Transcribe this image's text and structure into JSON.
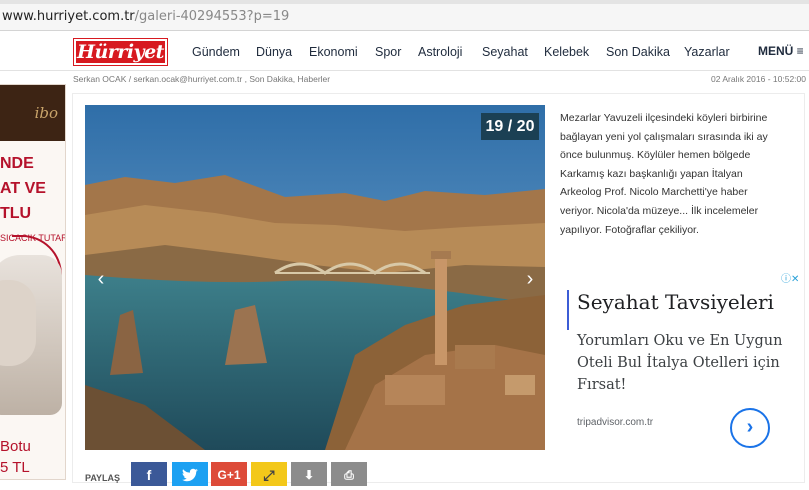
{
  "browser": {
    "url_host": "www.hurriyet.com.tr",
    "url_path": "/galeri-40294553?p=19"
  },
  "nav": {
    "logo": "Hürriyet",
    "links": [
      "Gündem",
      "Dünya",
      "Ekonomi",
      "Spor",
      "Astroloji",
      "Seyahat",
      "Kelebek",
      "Son Dakika",
      "Yazarlar"
    ],
    "menu_label": "MENÜ ≡"
  },
  "article": {
    "byline": "Serkan OCAK / serkan.ocak@hurriyet.com.tr , Son Dakika, Haberler",
    "date": "02 Aralık 2016 - 10:52:00",
    "counter": "19 / 20",
    "description": "Mezarlar Yavuzeli ilçesindeki köyleri birbirine bağlayan yeni yol çalışmaları sırasında iki ay önce bulunmuş. Köylüler hemen bölgede Karkamış kazı başkanlığı yapan İtalyan Arkeolog Prof. Nicolo Marchetti'ye haber veriyor. Nicola'da müzeye... İlk incelemeler yapılıyor. Fotoğraflar çekiliyor."
  },
  "left_ad": {
    "brand": "ibo",
    "headline_lines": [
      "NDE",
      "AT VE",
      "TLU"
    ],
    "tagline": "SICACIK TUTAR",
    "product": "Botu",
    "price": "5 TL"
  },
  "right_ad": {
    "title": "Seyahat Tavsiyeleri",
    "text": "Yorumları Oku ve En Uygun Oteli Bul İtalya Otelleri için Fırsat!",
    "url": "tripadvisor.com.tr",
    "cta_icon": "chevron-right-icon"
  },
  "share": {
    "label": "PAYLAŞ",
    "buttons": [
      {
        "icon": "facebook-icon",
        "glyph": "f",
        "color": "#3b5998"
      },
      {
        "icon": "twitter-icon",
        "glyph": "🐦",
        "color": "#1da1f2"
      },
      {
        "icon": "google-plus-icon",
        "glyph": "G+1",
        "color": "#dd4b39"
      },
      {
        "icon": "external-link-icon",
        "glyph": "⤢",
        "color": "#f3c81a"
      },
      {
        "icon": "download-icon",
        "glyph": "⬇",
        "color": "#8c8c8c"
      },
      {
        "icon": "print-icon",
        "glyph": "🖶",
        "color": "#8c8c8c"
      }
    ]
  },
  "colors": {
    "brand_red": "#d71920",
    "counter_bg": "#1b4054",
    "ad_blue": "#1a73e8"
  }
}
